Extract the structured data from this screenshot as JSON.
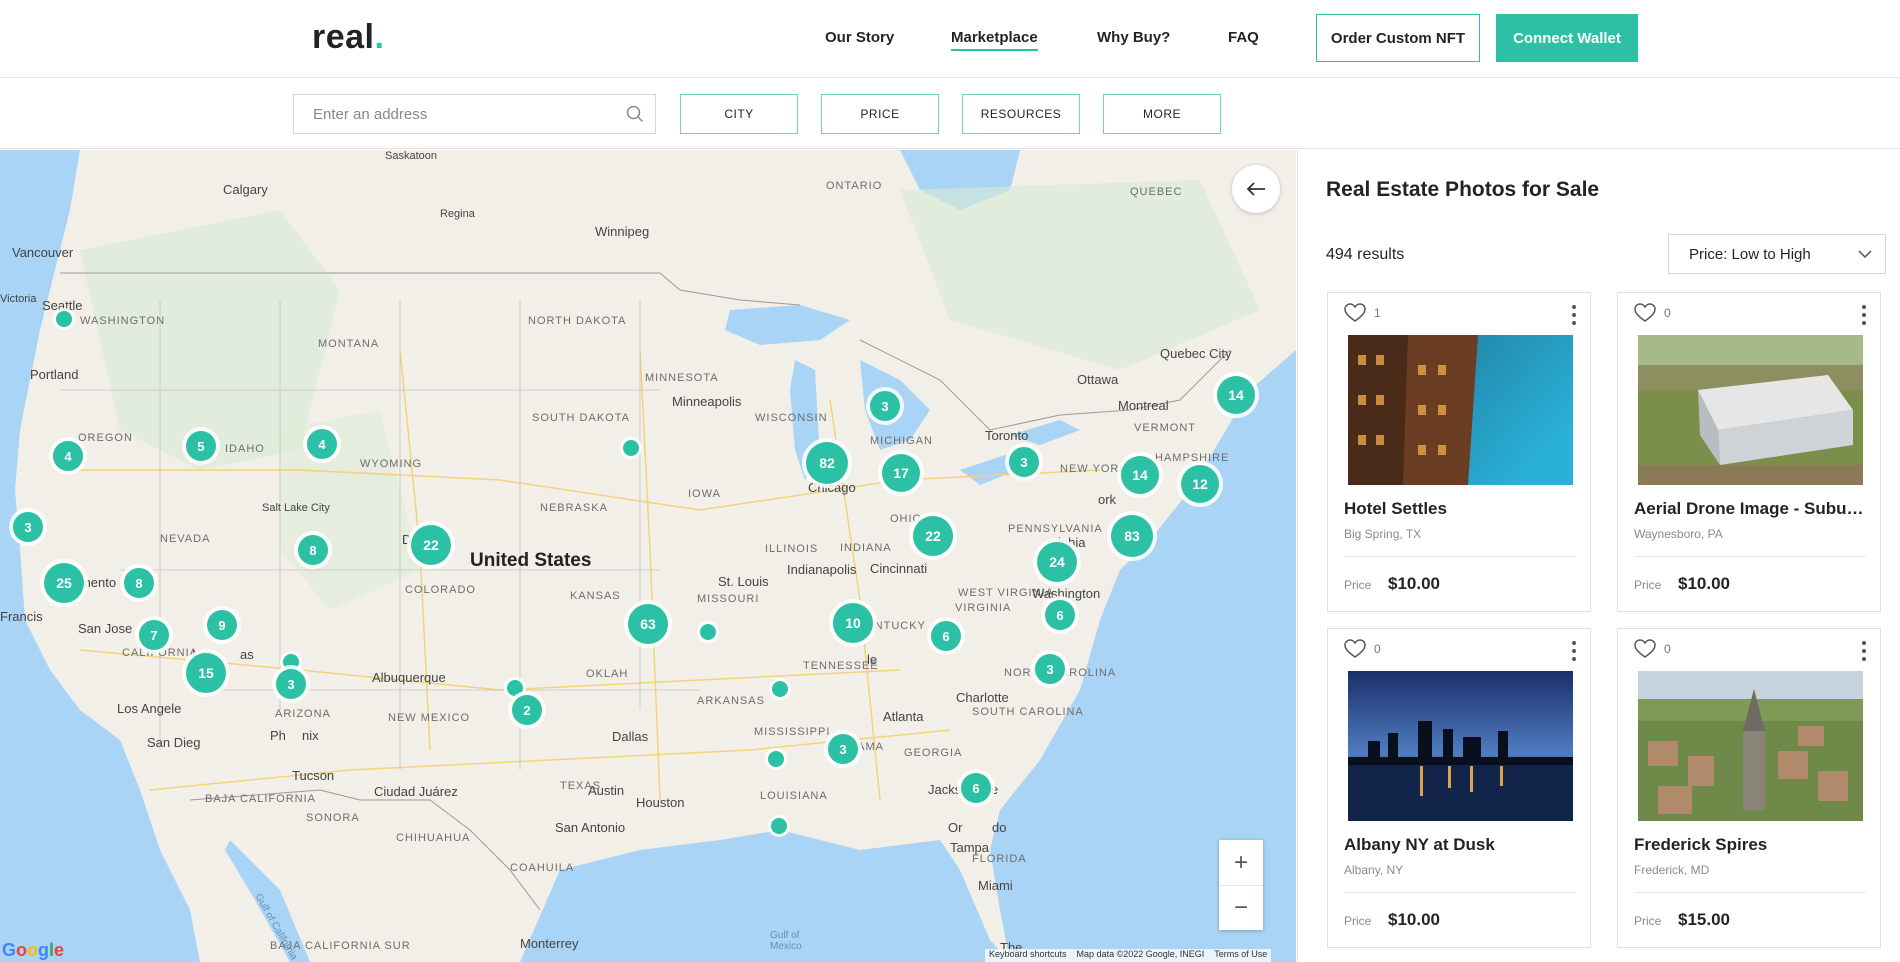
{
  "brand": {
    "name": "real",
    "dot": "."
  },
  "nav": {
    "links": [
      {
        "label": "Our Story"
      },
      {
        "label": "Marketplace"
      },
      {
        "label": "Why Buy?"
      },
      {
        "label": "FAQ"
      }
    ],
    "order_button": "Order Custom NFT",
    "wallet_button": "Connect Wallet"
  },
  "filters": {
    "search_placeholder": "Enter an address",
    "buttons": [
      "CITY",
      "PRICE",
      "RESOURCES",
      "MORE"
    ]
  },
  "map": {
    "labels": {
      "united_states": "United States",
      "ontario": "ONTARIO",
      "quebec": "QUEBEC",
      "saskatoon": "Saskatoon",
      "calgary": "Calgary",
      "regina": "Regina",
      "winnipeg": "Winnipeg",
      "vancouver": "Vancouver",
      "victoria": "Victoria",
      "seattle": "Seattle",
      "washington_state": "WASHINGTON",
      "portland": "Portland",
      "oregon": "OREGON",
      "idaho": "IDAHO",
      "montana": "MONTANA",
      "wyoming": "WYOMING",
      "north_dakota": "NORTH DAKOTA",
      "south_dakota": "SOUTH DAKOTA",
      "minnesota": "MINNESOTA",
      "minneapolis": "Minneapolis",
      "wisconsin": "WISCONSIN",
      "michigan": "MICHIGAN",
      "nebraska": "NEBRASKA",
      "iowa": "IOWA",
      "illinois": "ILLINOIS",
      "indiana": "INDIANA",
      "ohio": "OHIO",
      "nevada": "NEVADA",
      "salt_lake_city": "Salt Lake City",
      "colorado": "COLORADO",
      "kansas": "KANSAS",
      "missouri": "MISSOURI",
      "kentucky": "KENTUCKY",
      "virginia": "VIRGINIA",
      "west_virginia": "WEST VIRGINIA",
      "pennsylvania": "PENNSYLVANIA",
      "new_york_state": "NEW YORK",
      "vermont": "VERMONT",
      "new_hampshire": "HAMPSHIRE",
      "california": "CALIFORNIA",
      "arizona": "ARIZONA",
      "new_mexico": "NEW MEXICO",
      "oklahoma": "OKLAH",
      "arkansas": "ARKANSAS",
      "tennessee": "TENNESSEE",
      "mississippi": "MISSISSIPPI",
      "alabama": "ALABAMA",
      "georgia": "GEORGIA",
      "north_carolina": "NORTH CAROLINA",
      "south_carolina": "SOUTH CAROLINA",
      "texas": "TEXAS",
      "louisiana": "LOUISIANA",
      "florida": "FLORIDA",
      "baja_california": "BAJA CALIFORNIA",
      "sonora": "SONORA",
      "chihuahua": "CHIHUAHUA",
      "coahuila": "COAHUILA",
      "baja_california_sur": "BAJA CALIFORNIA SUR",
      "gulf_of_california": "Gulf of California",
      "gulf_of_mexico": "Gulf of Mexico",
      "sacramento": "Sacramento",
      "san_francisco": "Francis",
      "san_jose": "San Jose",
      "los_angeles": "Los Angele",
      "san_diego": "San Dieg",
      "las_vegas": "Las",
      "las_vegas_end": "as",
      "phoenix": "Ph",
      "phoenix_end": "nix",
      "tucson": "Tucson",
      "albuquerque": "Albuquerque",
      "denver_d": "D",
      "ciudad_juarez": "Ciudad Juárez",
      "dallas": "Dallas",
      "austin": "Austin",
      "houston": "Houston",
      "san_antonio": "San Antonio",
      "monterrey": "Monterrey",
      "st_louis": "St. Louis",
      "chicago": "Chicago",
      "indianapolis": "Indianapolis",
      "cincinnati": "Cincinnati",
      "nashville_end": "le",
      "atlanta": "Atlanta",
      "charlotte": "Charlotte",
      "jacksonville": "Jacksonville",
      "orlando": "Or",
      "orlando_end": "do",
      "tampa": "Tampa",
      "miami": "Miami",
      "washington_dc": "Washington",
      "philadelphia": "lphia",
      "new_york": "ork",
      "toronto": "Toronto",
      "ottawa": "Ottawa",
      "montreal": "Montreal",
      "quebec_city": "Quebec City",
      "the": "The"
    },
    "clusters": [
      {
        "label": "3"
      },
      {
        "label": "82"
      },
      {
        "label": "17"
      },
      {
        "label": "3"
      },
      {
        "label": "14"
      },
      {
        "label": "14"
      },
      {
        "label": "12"
      },
      {
        "label": "83"
      },
      {
        "label": "22"
      },
      {
        "label": "24"
      },
      {
        "label": "6"
      },
      {
        "label": "5"
      },
      {
        "label": "4"
      },
      {
        "label": "4"
      },
      {
        "label": "3"
      },
      {
        "label": "22"
      },
      {
        "label": "8"
      },
      {
        "label": "25"
      },
      {
        "label": "8"
      },
      {
        "label": "9"
      },
      {
        "label": "7"
      },
      {
        "label": "15"
      },
      {
        "label": "3"
      },
      {
        "label": "63"
      },
      {
        "label": "10"
      },
      {
        "label": "6"
      },
      {
        "label": "3"
      },
      {
        "label": "2"
      },
      {
        "label": "3"
      },
      {
        "label": "6"
      }
    ],
    "zoom_in": "+",
    "zoom_out": "−",
    "google_logo": "Google",
    "attribution": {
      "shortcuts": "Keyboard shortcuts",
      "data": "Map data ©2022 Google, INEGI",
      "terms": "Terms of Use"
    }
  },
  "listings": {
    "title": "Real Estate Photos for Sale",
    "results": "494 results",
    "sort": "Price: Low to High",
    "price_label": "Price",
    "cards": [
      {
        "title": "Hotel Settles",
        "location": "Big Spring, TX",
        "price": "$10.00",
        "likes": "1"
      },
      {
        "title": "Aerial Drone Image - Suburban",
        "location": "Waynesboro, PA",
        "price": "$10.00",
        "likes": "0"
      },
      {
        "title": "Albany NY at Dusk",
        "location": "Albany, NY",
        "price": "$10.00",
        "likes": "0"
      },
      {
        "title": "Frederick Spires",
        "location": "Frederick, MD",
        "price": "$15.00",
        "likes": "0"
      }
    ]
  },
  "colors": {
    "accent": "#2cc1a4",
    "water": "#a9d4f5",
    "land": "#f1efe8"
  }
}
